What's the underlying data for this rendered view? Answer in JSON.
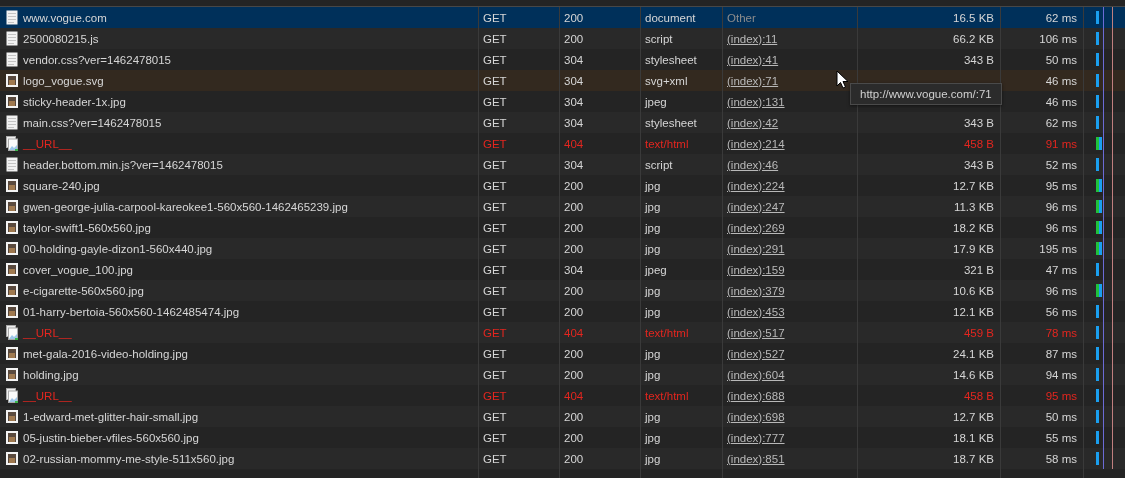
{
  "rows": [
    {
      "name": "www.vogue.com",
      "kind": "document",
      "method": "GET",
      "status": "200",
      "type": "document",
      "initiator": "Other",
      "initiator_link": false,
      "size": "16.5 KB",
      "time": "62 ms",
      "error": false,
      "selected": true,
      "hovered": false,
      "waiting": false
    },
    {
      "name": "2500080215.js",
      "kind": "document",
      "method": "GET",
      "status": "200",
      "type": "script",
      "initiator": "(index):11",
      "initiator_link": true,
      "size": "66.2 KB",
      "time": "106 ms",
      "error": false,
      "selected": false,
      "hovered": false,
      "waiting": false
    },
    {
      "name": "vendor.css?ver=1462478015",
      "kind": "document",
      "method": "GET",
      "status": "304",
      "type": "stylesheet",
      "initiator": "(index):41",
      "initiator_link": true,
      "size": "343 B",
      "time": "50 ms",
      "error": false,
      "selected": false,
      "hovered": false,
      "waiting": false
    },
    {
      "name": "logo_vogue.svg",
      "kind": "image",
      "method": "GET",
      "status": "304",
      "type": "svg+xml",
      "initiator": "(index):71",
      "initiator_link": true,
      "time": "46 ms",
      "error": false,
      "selected": false,
      "hovered": true,
      "waiting": false
    },
    {
      "name": "sticky-header-1x.jpg",
      "kind": "image",
      "method": "GET",
      "status": "304",
      "type": "jpeg",
      "initiator": "(index):131",
      "initiator_link": true,
      "time": "46 ms",
      "error": false,
      "selected": false,
      "hovered": false,
      "waiting": false
    },
    {
      "name": "main.css?ver=1462478015",
      "kind": "document",
      "method": "GET",
      "status": "304",
      "type": "stylesheet",
      "initiator": "(index):42",
      "initiator_link": true,
      "size": "343 B",
      "time": "62 ms",
      "error": false,
      "selected": false,
      "hovered": false,
      "waiting": false
    },
    {
      "name": "__URL__",
      "kind": "broken",
      "method": "GET",
      "status": "404",
      "type": "text/html",
      "initiator": "(index):214",
      "initiator_link": true,
      "size": "458 B",
      "time": "91 ms",
      "error": true,
      "selected": false,
      "hovered": false,
      "waiting": true
    },
    {
      "name": "header.bottom.min.js?ver=1462478015",
      "kind": "document",
      "method": "GET",
      "status": "304",
      "type": "script",
      "initiator": "(index):46",
      "initiator_link": true,
      "size": "343 B",
      "time": "52 ms",
      "error": false,
      "selected": false,
      "hovered": false,
      "waiting": false
    },
    {
      "name": "square-240.jpg",
      "kind": "image",
      "method": "GET",
      "status": "200",
      "type": "jpg",
      "initiator": "(index):224",
      "initiator_link": true,
      "size": "12.7 KB",
      "time": "95 ms",
      "error": false,
      "selected": false,
      "hovered": false,
      "waiting": true
    },
    {
      "name": "gwen-george-julia-carpool-kareokee1-560x560-1462465239.jpg",
      "kind": "image",
      "method": "GET",
      "status": "200",
      "type": "jpg",
      "initiator": "(index):247",
      "initiator_link": true,
      "size": "11.3 KB",
      "time": "96 ms",
      "error": false,
      "selected": false,
      "hovered": false,
      "waiting": true
    },
    {
      "name": "taylor-swift1-560x560.jpg",
      "kind": "image",
      "method": "GET",
      "status": "200",
      "type": "jpg",
      "initiator": "(index):269",
      "initiator_link": true,
      "size": "18.2 KB",
      "time": "96 ms",
      "error": false,
      "selected": false,
      "hovered": false,
      "waiting": true
    },
    {
      "name": "00-holding-gayle-dizon1-560x440.jpg",
      "kind": "image",
      "method": "GET",
      "status": "200",
      "type": "jpg",
      "initiator": "(index):291",
      "initiator_link": true,
      "size": "17.9 KB",
      "time": "195 ms",
      "error": false,
      "selected": false,
      "hovered": false,
      "waiting": true
    },
    {
      "name": "cover_vogue_100.jpg",
      "kind": "image",
      "method": "GET",
      "status": "304",
      "type": "jpeg",
      "initiator": "(index):159",
      "initiator_link": true,
      "size": "321 B",
      "time": "47 ms",
      "error": false,
      "selected": false,
      "hovered": false,
      "waiting": false
    },
    {
      "name": "e-cigarette-560x560.jpg",
      "kind": "image",
      "method": "GET",
      "status": "200",
      "type": "jpg",
      "initiator": "(index):379",
      "initiator_link": true,
      "size": "10.6 KB",
      "time": "96 ms",
      "error": false,
      "selected": false,
      "hovered": false,
      "waiting": true
    },
    {
      "name": "01-harry-bertoia-560x560-1462485474.jpg",
      "kind": "image",
      "method": "GET",
      "status": "200",
      "type": "jpg",
      "initiator": "(index):453",
      "initiator_link": true,
      "size": "12.1 KB",
      "time": "56 ms",
      "error": false,
      "selected": false,
      "hovered": false,
      "waiting": false
    },
    {
      "name": "__URL__",
      "kind": "broken",
      "method": "GET",
      "status": "404",
      "type": "text/html",
      "initiator": "(index):517",
      "initiator_link": true,
      "size": "459 B",
      "time": "78 ms",
      "error": true,
      "selected": false,
      "hovered": false,
      "waiting": false
    },
    {
      "name": "met-gala-2016-video-holding.jpg",
      "kind": "image",
      "method": "GET",
      "status": "200",
      "type": "jpg",
      "initiator": "(index):527",
      "initiator_link": true,
      "size": "24.1 KB",
      "time": "87 ms",
      "error": false,
      "selected": false,
      "hovered": false,
      "waiting": false
    },
    {
      "name": "holding.jpg",
      "kind": "image",
      "method": "GET",
      "status": "200",
      "type": "jpg",
      "initiator": "(index):604",
      "initiator_link": true,
      "size": "14.6 KB",
      "time": "94 ms",
      "error": false,
      "selected": false,
      "hovered": false,
      "waiting": false
    },
    {
      "name": "__URL__",
      "kind": "broken",
      "method": "GET",
      "status": "404",
      "type": "text/html",
      "initiator": "(index):688",
      "initiator_link": true,
      "size": "458 B",
      "time": "95 ms",
      "error": true,
      "selected": false,
      "hovered": false,
      "waiting": false
    },
    {
      "name": "1-edward-met-glitter-hair-small.jpg",
      "kind": "image",
      "method": "GET",
      "status": "200",
      "type": "jpg",
      "initiator": "(index):698",
      "initiator_link": true,
      "size": "12.7 KB",
      "time": "50 ms",
      "error": false,
      "selected": false,
      "hovered": false,
      "waiting": false
    },
    {
      "name": "05-justin-bieber-vfiles-560x560.jpg",
      "kind": "image",
      "method": "GET",
      "status": "200",
      "type": "jpg",
      "initiator": "(index):777",
      "initiator_link": true,
      "size": "18.1 KB",
      "time": "55 ms",
      "error": false,
      "selected": false,
      "hovered": false,
      "waiting": false
    },
    {
      "name": "02-russian-mommy-me-style-511x560.jpg",
      "kind": "image",
      "method": "GET",
      "status": "200",
      "type": "jpg",
      "initiator": "(index):851",
      "initiator_link": true,
      "size": "18.7 KB",
      "time": "58 ms",
      "error": false,
      "selected": false,
      "hovered": false,
      "waiting": false
    }
  ],
  "tooltip": {
    "text": "http://www.vogue.com/:71"
  }
}
